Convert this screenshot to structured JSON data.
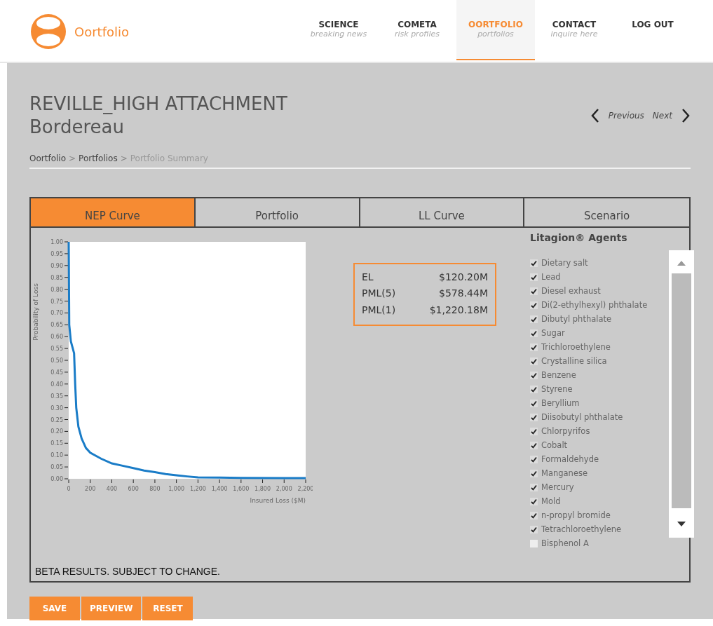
{
  "brand": {
    "name": "Oortfolio"
  },
  "nav": [
    {
      "label": "SCIENCE",
      "sub": "breaking news",
      "selected": false
    },
    {
      "label": "COMETA",
      "sub": "risk profiles",
      "selected": false
    },
    {
      "label": "OORTFOLIO",
      "sub": "portfolios",
      "selected": true
    },
    {
      "label": "CONTACT",
      "sub": "inquire here",
      "selected": false
    },
    {
      "label": "LOG OUT",
      "selected": false
    }
  ],
  "title": {
    "line1": "REVILLE_HIGH ATTACHMENT",
    "line2": "Bordereau"
  },
  "pager": {
    "previous": "Previous",
    "next": "Next"
  },
  "breadcrumb": {
    "separator": ">",
    "items": [
      "Oortfolio",
      "Portfolios",
      "Portfolio Summary"
    ]
  },
  "tabs": [
    {
      "label": "NEP Curve",
      "selected": true
    },
    {
      "label": "Portfolio",
      "selected": false
    },
    {
      "label": "LL Curve",
      "selected": false
    },
    {
      "label": "Scenario",
      "selected": false
    }
  ],
  "chart_data": {
    "type": "line",
    "xlabel": "Insured Loss ($M)",
    "ylabel": "Probability of Loss",
    "xlim": [
      0,
      2200
    ],
    "ylim": [
      0,
      1
    ],
    "xticks": [
      0,
      200,
      400,
      600,
      800,
      {
        "value": 1000,
        "label": "1,000"
      },
      {
        "value": 1200,
        "label": "1,200"
      },
      {
        "value": 1400,
        "label": "1,400"
      },
      {
        "value": 1600,
        "label": "1,600"
      },
      {
        "value": 1800,
        "label": "1,800"
      },
      {
        "value": 2000,
        "label": "2,000"
      },
      {
        "value": 2200,
        "label": "2,200"
      }
    ],
    "yticks": [
      {
        "value": 0,
        "label": "0.00"
      },
      {
        "value": 0.05,
        "label": "0.05"
      },
      {
        "value": 0.1,
        "label": "0.10"
      },
      {
        "value": 0.15,
        "label": "0.15"
      },
      {
        "value": 0.2,
        "label": "0.20"
      },
      {
        "value": 0.25,
        "label": "0.25"
      },
      {
        "value": 0.3,
        "label": "0.30"
      },
      {
        "value": 0.35,
        "label": "0.35"
      },
      {
        "value": 0.4,
        "label": "0.40"
      },
      {
        "value": 0.45,
        "label": "0.45"
      },
      {
        "value": 0.5,
        "label": "0.50"
      },
      {
        "value": 0.55,
        "label": "0.55"
      },
      {
        "value": 0.6,
        "label": "0.60"
      },
      {
        "value": 0.65,
        "label": "0.65"
      },
      {
        "value": 0.7,
        "label": "0.70"
      },
      {
        "value": 0.75,
        "label": "0.75"
      },
      {
        "value": 0.8,
        "label": "0.80"
      },
      {
        "value": 0.85,
        "label": "0.85"
      },
      {
        "value": 0.9,
        "label": "0.90"
      },
      {
        "value": 0.95,
        "label": "0.95"
      },
      {
        "value": 1,
        "label": "1.00"
      }
    ],
    "x": [
      0,
      5,
      20,
      50,
      60,
      70,
      90,
      120,
      160,
      200,
      300,
      400,
      500,
      600,
      700,
      800,
      900,
      1000,
      1100,
      1200,
      1400,
      1600,
      2000,
      2200
    ],
    "series": [
      {
        "color": "#1a7cc7",
        "values": [
          1.0,
          0.65,
          0.58,
          0.53,
          0.4,
          0.3,
          0.22,
          0.17,
          0.13,
          0.11,
          0.085,
          0.065,
          0.055,
          0.045,
          0.035,
          0.028,
          0.02,
          0.015,
          0.01,
          0.006,
          0.005,
          0.004,
          0.003,
          0.003
        ]
      }
    ]
  },
  "stats": [
    {
      "label": "EL",
      "value": "$120.20M"
    },
    {
      "label": "PML(5)",
      "value": "$578.44M"
    },
    {
      "label": "PML(1)",
      "value": "$1,220.18M"
    }
  ],
  "agents": {
    "title": "Litagion® Agents",
    "items": [
      {
        "label": "Dietary salt",
        "checked": true
      },
      {
        "label": "Lead",
        "checked": true
      },
      {
        "label": "Diesel exhaust",
        "checked": true
      },
      {
        "label": "Di(2-ethylhexyl) phthalate",
        "checked": true
      },
      {
        "label": "Dibutyl phthalate",
        "checked": true
      },
      {
        "label": "Sugar",
        "checked": true
      },
      {
        "label": "Trichloroethylene",
        "checked": true
      },
      {
        "label": "Crystalline silica",
        "checked": true
      },
      {
        "label": "Benzene",
        "checked": true
      },
      {
        "label": "Styrene",
        "checked": true
      },
      {
        "label": "Beryllium",
        "checked": true
      },
      {
        "label": "Diisobutyl phthalate",
        "checked": true
      },
      {
        "label": "Chlorpyrifos",
        "checked": true
      },
      {
        "label": "Cobalt",
        "checked": true
      },
      {
        "label": "Formaldehyde",
        "checked": true
      },
      {
        "label": "Manganese",
        "checked": true
      },
      {
        "label": "Mercury",
        "checked": true
      },
      {
        "label": "Mold",
        "checked": true
      },
      {
        "label": "n-propyl bromide",
        "checked": true
      },
      {
        "label": "Tetrachloroethylene",
        "checked": true
      },
      {
        "label": "Bisphenol A",
        "checked": false
      }
    ]
  },
  "notice": "BETA RESULTS. SUBJECT TO CHANGE.",
  "buttons": [
    "SAVE",
    "PREVIEW",
    "RESET"
  ]
}
